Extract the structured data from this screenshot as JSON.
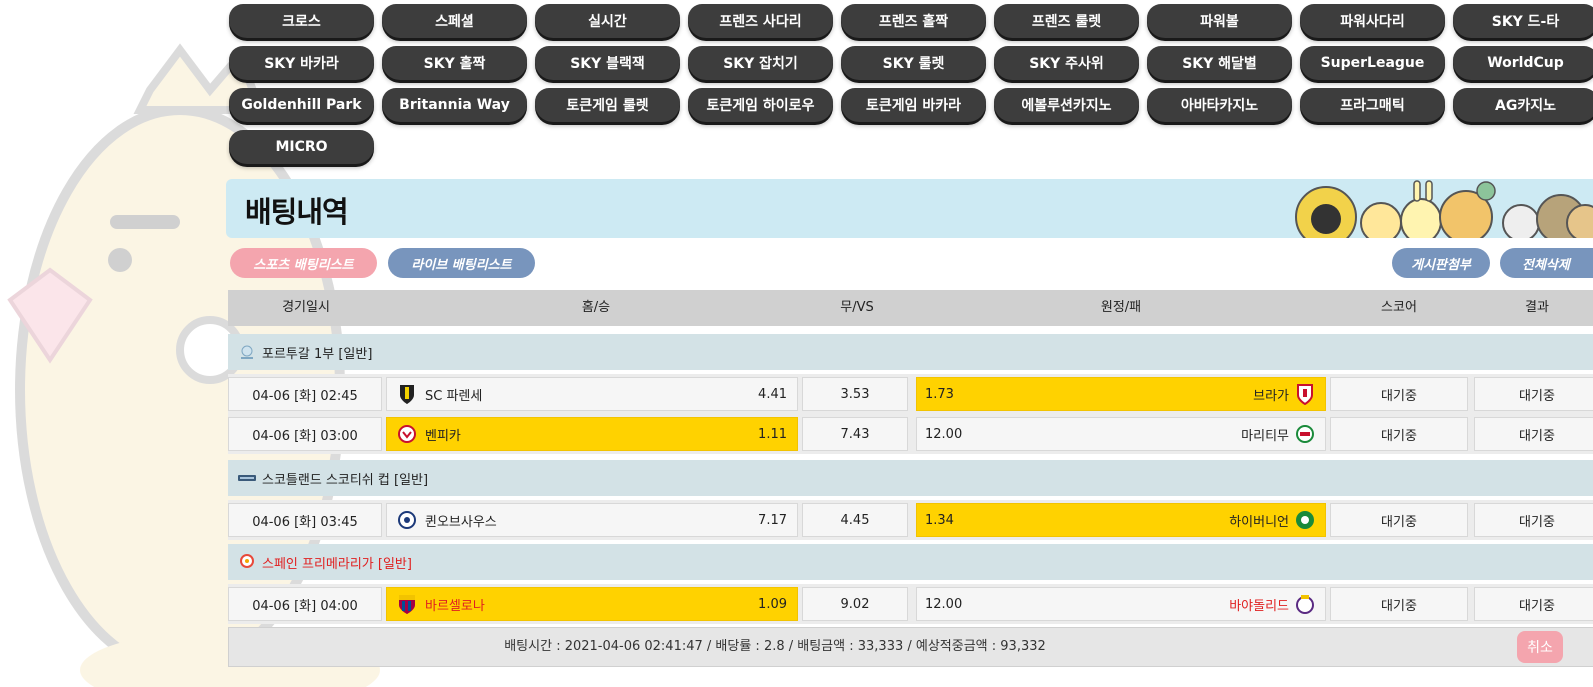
{
  "games": [
    "크로스",
    "스페셜",
    "실시간",
    "프렌즈 사다리",
    "프렌즈 홀짝",
    "프렌즈 룰렛",
    "파워볼",
    "파워사다리",
    "SKY 드-타",
    "SKY 바카라",
    "SKY 홀짝",
    "SKY 블랙잭",
    "SKY 잡치기",
    "SKY 룰렛",
    "SKY 주사위",
    "SKY 해달별",
    "SuperLeague",
    "WorldCup",
    "Goldenhill Park",
    "Britannia Way",
    "토큰게임 룰렛",
    "토큰게임 하이로우",
    "토큰게임 바카라",
    "에볼루션카지노",
    "아바타카지노",
    "프라그매틱",
    "AG카지노",
    "MICRO"
  ],
  "page_title": "배팅내역",
  "tabs": {
    "sports": "스포츠 배팅리스트",
    "live": "라이브 배팅리스트",
    "attach": "게시판첨부",
    "delete_all": "전체삭제"
  },
  "table": {
    "headers": [
      "경기일시",
      "홈/승",
      "무/VS",
      "원정/패",
      "스코어",
      "결과"
    ],
    "leagues": [
      {
        "name": "포르투갈 1부 [일반]",
        "icon": "portugal-league-icon",
        "matches": [
          {
            "date": "04-06 [화] 02:45",
            "home": "SC 파렌세",
            "home_odds": "4.41",
            "draw_odds": "3.53",
            "away_odds": "1.73",
            "away": "브라가",
            "score": "대기중",
            "result": "대기중",
            "pick": "away"
          },
          {
            "date": "04-06 [화] 03:00",
            "home": "벤피카",
            "home_odds": "1.11",
            "draw_odds": "7.43",
            "away_odds": "12.00",
            "away": "마리티무",
            "score": "대기중",
            "result": "대기중",
            "pick": "home"
          }
        ]
      },
      {
        "name": "스코틀랜드 스코티쉬 컵 [일반]",
        "icon": "scotland-cup-icon",
        "matches": [
          {
            "date": "04-06 [화] 03:45",
            "home": "퀸오브사우스",
            "home_odds": "7.17",
            "draw_odds": "4.45",
            "away_odds": "1.34",
            "away": "하이버니언",
            "score": "대기중",
            "result": "대기중",
            "pick": "away"
          }
        ]
      },
      {
        "name": "스페인 프리메라리가 [일반]",
        "icon": "laliga-icon",
        "matches": [
          {
            "date": "04-06 [화] 04:00",
            "home": "바르셀로나",
            "home_odds": "1.09",
            "draw_odds": "9.02",
            "away_odds": "12.00",
            "away": "바야돌리드",
            "score": "대기중",
            "result": "대기중",
            "pick": "home"
          }
        ]
      }
    ]
  },
  "summary": {
    "text": "배팅시간 : 2021-04-06 02:41:47   /   배당률 : 2.8   /   배팅금액 : 33,333   /   예상적중금액 : 93,332",
    "cancel": "취소"
  },
  "colors": {
    "pick": "#ffd200",
    "league_bg": "#d3e2e6",
    "banner_bg": "#cdeaf3",
    "game_btn": "#3d3d3d",
    "pink": "#f4a5ae",
    "blue": "#7895bd"
  }
}
